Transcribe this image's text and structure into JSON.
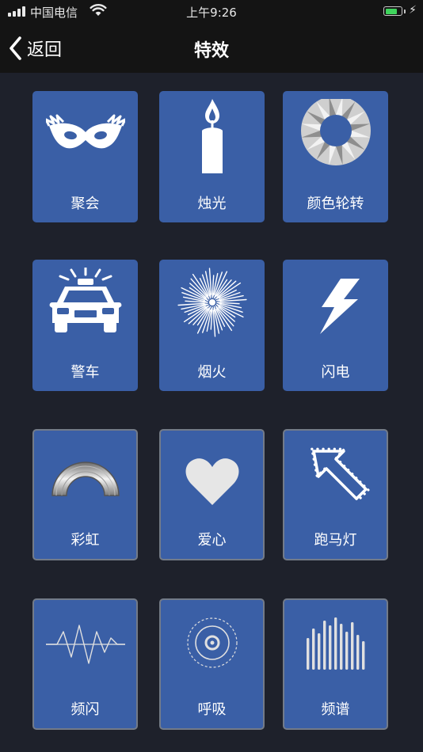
{
  "status_bar": {
    "carrier": "中国电信",
    "time": "上午9:26",
    "battery_level": 0.8
  },
  "nav": {
    "back_label": "返回",
    "title": "特效"
  },
  "effects": [
    {
      "label": "聚会",
      "icon": "party-mask-icon"
    },
    {
      "label": "烛光",
      "icon": "candle-icon"
    },
    {
      "label": "颜色轮转",
      "icon": "color-wheel-icon"
    },
    {
      "label": "警车",
      "icon": "police-car-icon"
    },
    {
      "label": "烟火",
      "icon": "fireworks-icon"
    },
    {
      "label": "闪电",
      "icon": "lightning-icon"
    },
    {
      "label": "彩虹",
      "icon": "rainbow-icon"
    },
    {
      "label": "爱心",
      "icon": "heart-icon"
    },
    {
      "label": "跑马灯",
      "icon": "marquee-arrow-icon"
    },
    {
      "label": "频闪",
      "icon": "strobe-wave-icon"
    },
    {
      "label": "呼吸",
      "icon": "breathing-circle-icon"
    },
    {
      "label": "频谱",
      "icon": "spectrum-bars-icon"
    }
  ],
  "colors": {
    "background": "#1e212b",
    "bar": "#141414",
    "tile": "#3a5fa6",
    "tile_border": "#737b88",
    "battery": "#3fd45c"
  }
}
